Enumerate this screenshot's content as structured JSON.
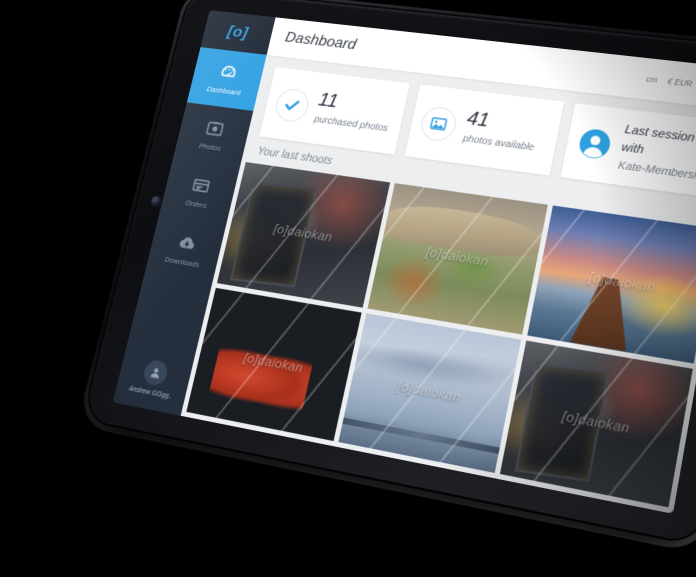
{
  "app": {
    "logo": "[o]",
    "logo_icon": "brackets-o-logo"
  },
  "sidebar": {
    "items": [
      {
        "label": "Dashboard",
        "icon": "dashboard-icon",
        "active": true
      },
      {
        "label": "Photos",
        "icon": "photos-icon",
        "active": false
      },
      {
        "label": "Orders",
        "icon": "orders-icon",
        "active": false
      },
      {
        "label": "Downloads",
        "icon": "downloads-cloud-icon",
        "active": false
      }
    ],
    "user": {
      "name": "Andrew GGgg..",
      "avatar_icon": "user-avatar-icon"
    }
  },
  "topbar": {
    "title": "Dashboard",
    "unit": "cm",
    "currency": "€ EUR",
    "cart_icon": "shopping-cart-icon"
  },
  "cards": [
    {
      "icon": "check-icon",
      "value": "11",
      "label": "purchased photos"
    },
    {
      "icon": "image-icon",
      "value": "41",
      "label": "photos available"
    },
    {
      "icon": "user-circle-icon",
      "value": "Last session with",
      "label": "Kate-Membership"
    }
  ],
  "gallery": {
    "title": "Your last shoots",
    "watermark": "[o]daiokan",
    "photos": [
      {
        "alt": "snowy-lantern",
        "art": "art-lantern"
      },
      {
        "alt": "koi-pond-rocks",
        "art": "art-pond"
      },
      {
        "alt": "sunset-lake-pier",
        "art": "art-pier"
      },
      {
        "alt": "sunglasses-beach-sunset",
        "art": "art-shades"
      },
      {
        "alt": "sea-islands-clouds",
        "art": "art-sea"
      },
      {
        "alt": "snowy-lantern-2",
        "art": "art-lantern"
      }
    ]
  },
  "colors": {
    "accent": "#2fa0e2",
    "sidebar": "#242e3d",
    "logo_bg": "#1c2633",
    "page_bg": "#eceef0",
    "green": "#3fae52"
  }
}
